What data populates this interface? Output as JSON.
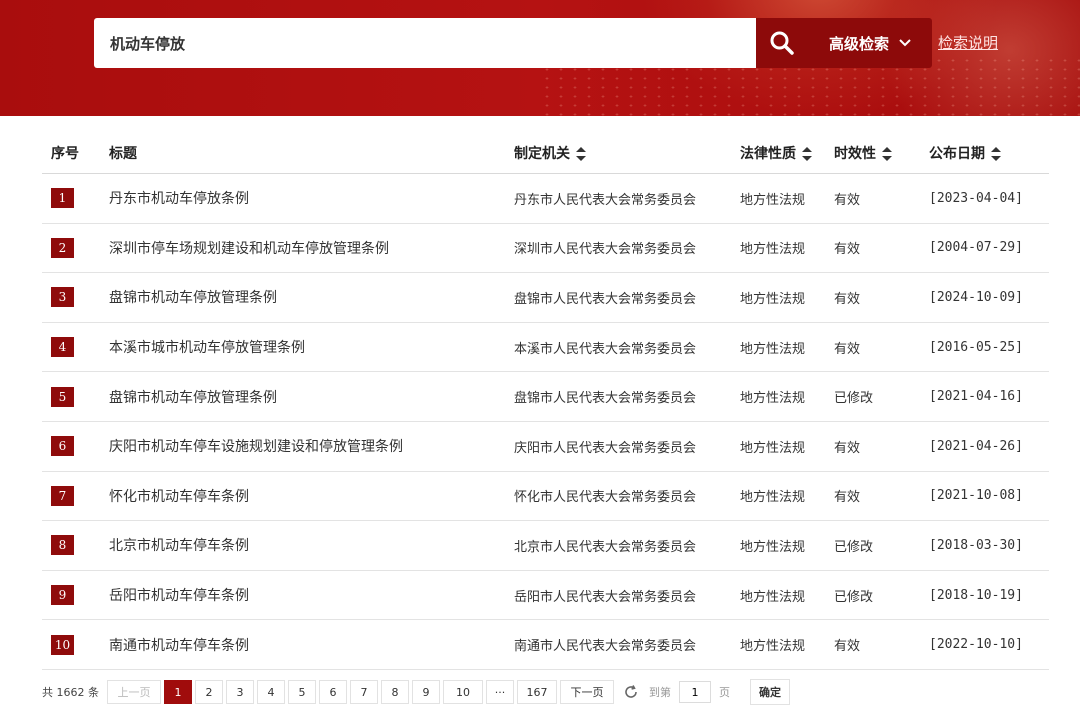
{
  "search": {
    "query": "机动车停放",
    "advanced_label": "高级检索",
    "help_label": "检索说明"
  },
  "table": {
    "headers": {
      "index": "序号",
      "title": "标题",
      "authority": "制定机关",
      "nature": "法律性质",
      "validity": "时效性",
      "date": "公布日期"
    },
    "rows": [
      {
        "index": "1",
        "title": "丹东市机动车停放条例",
        "authority": "丹东市人民代表大会常务委员会",
        "nature": "地方性法规",
        "validity": "有效",
        "date": "[2023-04-04]"
      },
      {
        "index": "2",
        "title": "深圳市停车场规划建设和机动车停放管理条例",
        "authority": "深圳市人民代表大会常务委员会",
        "nature": "地方性法规",
        "validity": "有效",
        "date": "[2004-07-29]"
      },
      {
        "index": "3",
        "title": "盘锦市机动车停放管理条例",
        "authority": "盘锦市人民代表大会常务委员会",
        "nature": "地方性法规",
        "validity": "有效",
        "date": "[2024-10-09]"
      },
      {
        "index": "4",
        "title": "本溪市城市机动车停放管理条例",
        "authority": "本溪市人民代表大会常务委员会",
        "nature": "地方性法规",
        "validity": "有效",
        "date": "[2016-05-25]"
      },
      {
        "index": "5",
        "title": "盘锦市机动车停放管理条例",
        "authority": "盘锦市人民代表大会常务委员会",
        "nature": "地方性法规",
        "validity": "已修改",
        "date": "[2021-04-16]"
      },
      {
        "index": "6",
        "title": "庆阳市机动车停车设施规划建设和停放管理条例",
        "authority": "庆阳市人民代表大会常务委员会",
        "nature": "地方性法规",
        "validity": "有效",
        "date": "[2021-04-26]"
      },
      {
        "index": "7",
        "title": "怀化市机动车停车条例",
        "authority": "怀化市人民代表大会常务委员会",
        "nature": "地方性法规",
        "validity": "有效",
        "date": "[2021-10-08]"
      },
      {
        "index": "8",
        "title": "北京市机动车停车条例",
        "authority": "北京市人民代表大会常务委员会",
        "nature": "地方性法规",
        "validity": "已修改",
        "date": "[2018-03-30]"
      },
      {
        "index": "9",
        "title": "岳阳市机动车停车条例",
        "authority": "岳阳市人民代表大会常务委员会",
        "nature": "地方性法规",
        "validity": "已修改",
        "date": "[2018-10-19]"
      },
      {
        "index": "10",
        "title": "南通市机动车停车条例",
        "authority": "南通市人民代表大会常务委员会",
        "nature": "地方性法规",
        "validity": "有效",
        "date": "[2022-10-10]"
      }
    ]
  },
  "pagination": {
    "total_text": "共 1662 条",
    "prev_label": "上一页",
    "pages": [
      "1",
      "2",
      "3",
      "4",
      "5",
      "6",
      "7",
      "8",
      "9",
      "10"
    ],
    "current_page": "1",
    "ellipsis": "···",
    "last_page": "167",
    "next_label": "下一页",
    "goto_prefix": "到第",
    "goto_value": "1",
    "goto_suffix": "页",
    "confirm_label": "确定"
  },
  "colors": {
    "brand_red": "#b51212",
    "button_dark_red": "#8d0a0a",
    "badge_red": "#8f0b0b"
  }
}
